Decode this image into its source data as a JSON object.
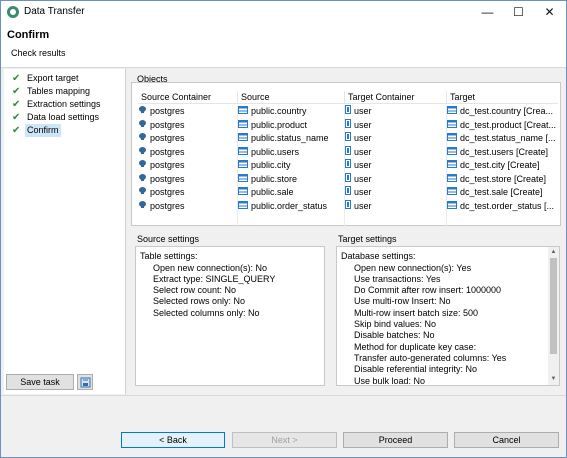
{
  "window": {
    "title": "Data Transfer"
  },
  "header": {
    "title": "Confirm",
    "subtitle": "Check results"
  },
  "nav": {
    "items": [
      {
        "label": "Export target",
        "done": true
      },
      {
        "label": "Tables mapping",
        "done": true
      },
      {
        "label": "Extraction settings",
        "done": true
      },
      {
        "label": "Data load settings",
        "done": true
      },
      {
        "label": "Confirm",
        "done": true,
        "active": true
      }
    ],
    "save_task_label": "Save task"
  },
  "objects": {
    "group_label": "Objects",
    "columns": [
      "Source Container",
      "Source",
      "Target Container",
      "Target"
    ],
    "rows": [
      {
        "source_container": "postgres",
        "source": "public.country",
        "target_container": "user",
        "target": "dc_test.country [Crea..."
      },
      {
        "source_container": "postgres",
        "source": "public.product",
        "target_container": "user",
        "target": "dc_test.product [Creat..."
      },
      {
        "source_container": "postgres",
        "source": "public.status_name",
        "target_container": "user",
        "target": "dc_test.status_name [..."
      },
      {
        "source_container": "postgres",
        "source": "public.users",
        "target_container": "user",
        "target": "dc_test.users [Create]"
      },
      {
        "source_container": "postgres",
        "source": "public.city",
        "target_container": "user",
        "target": "dc_test.city [Create]"
      },
      {
        "source_container": "postgres",
        "source": "public.store",
        "target_container": "user",
        "target": "dc_test.store [Create]"
      },
      {
        "source_container": "postgres",
        "source": "public.sale",
        "target_container": "user",
        "target": "dc_test.sale [Create]"
      },
      {
        "source_container": "postgres",
        "source": "public.order_status",
        "target_container": "user",
        "target": "dc_test.order_status [..."
      }
    ]
  },
  "source_settings": {
    "group_label": "Source settings",
    "heading": "Table settings:",
    "lines": [
      "Open new connection(s): No",
      "Extract type: SINGLE_QUERY",
      "Select row count: No",
      "Selected rows only: No",
      "Selected columns only: No"
    ]
  },
  "target_settings": {
    "group_label": "Target settings",
    "heading": "Database settings:",
    "lines": [
      "Open new connection(s): Yes",
      "Use transactions: Yes",
      "Do Commit after row insert: 1000000",
      "Use multi-row Insert: No",
      "Multi-row insert batch size: 500",
      "Skip bind values: No",
      "Disable batches: No",
      "Method for duplicate key case:",
      "Transfer auto-generated columns: Yes",
      "Disable referential integrity: No",
      "Use bulk load: No"
    ]
  },
  "footer": {
    "back_label": "< Back",
    "next_label": "Next >",
    "proceed_label": "Proceed",
    "cancel_label": "Cancel"
  },
  "colors": {
    "accent": "#0078d7",
    "check": "#2e8b3c",
    "selection": "#cde6f7"
  }
}
